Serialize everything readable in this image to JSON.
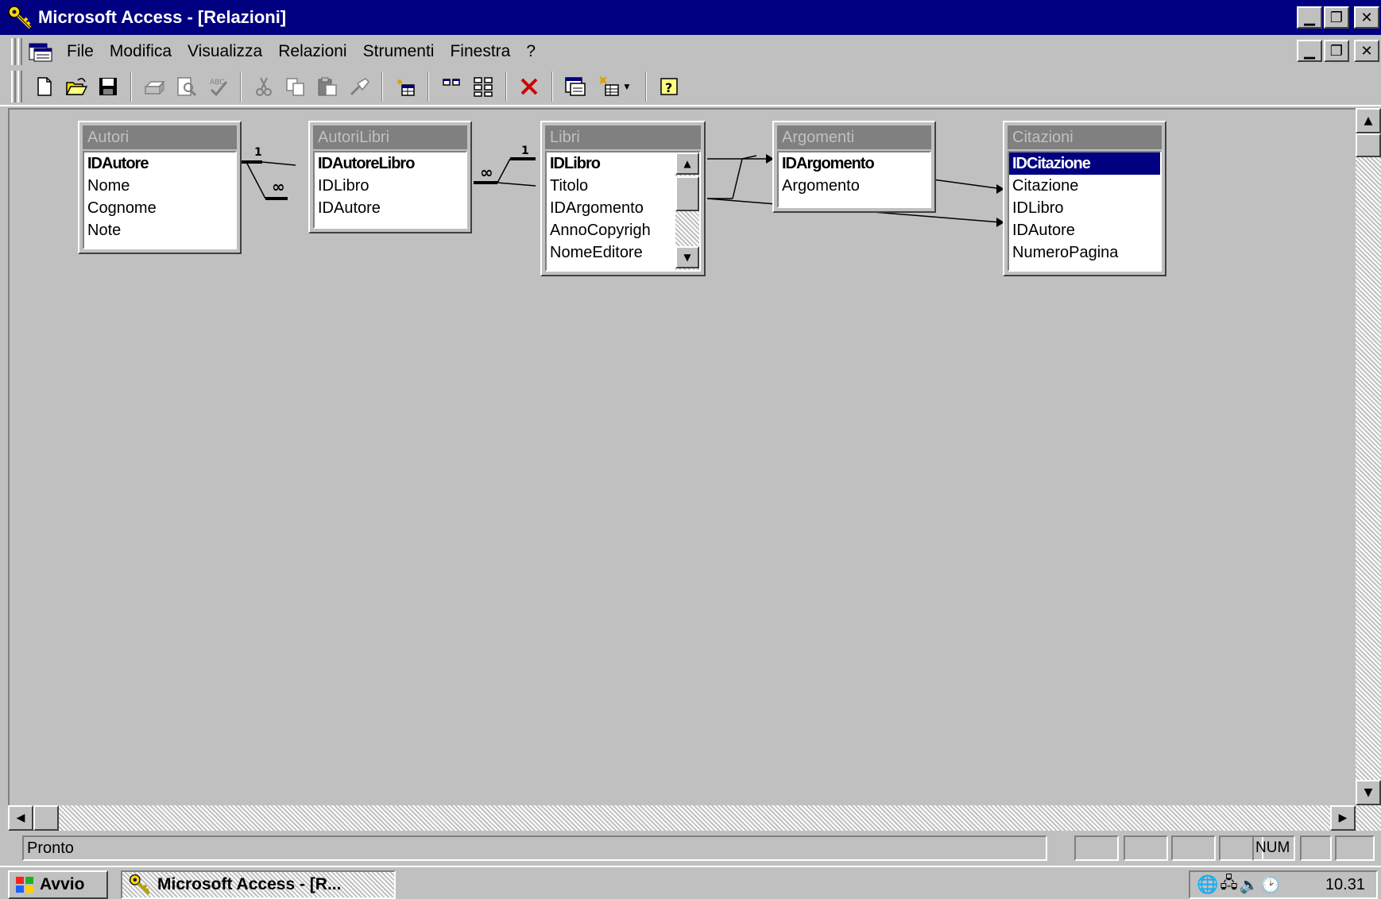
{
  "window": {
    "title": "Microsoft Access - [Relazioni]",
    "controls": {
      "minimize": "_",
      "restore": "🗗",
      "close": "✕"
    }
  },
  "menu": {
    "items": [
      "File",
      "Modifica",
      "Visualizza",
      "Relazioni",
      "Strumenti",
      "Finestra",
      "?"
    ],
    "underlines": [
      "F",
      "M",
      "V",
      "R",
      "S",
      "n",
      "?"
    ]
  },
  "toolbar": {
    "buttons": [
      "new-icon",
      "open-icon",
      "save-icon",
      "print-icon",
      "print-preview-icon",
      "spelling-icon",
      "cut-icon",
      "copy-icon",
      "paste-icon",
      "format-painter-icon",
      "show-table-icon",
      "show-direct-icon",
      "show-all-icon",
      "delete-icon",
      "database-window-icon",
      "new-object-icon",
      "help-icon"
    ]
  },
  "relationships": {
    "one_label": "1",
    "many_label": "∞",
    "tables": [
      {
        "id": "autori",
        "title": "Autori",
        "fields": [
          "IDAutore",
          "Nome",
          "Cognome",
          "Note"
        ],
        "primary_key": "IDAutore"
      },
      {
        "id": "autorilibri",
        "title": "AutoriLibri",
        "fields": [
          "IDAutoreLibro",
          "IDLibro",
          "IDAutore"
        ],
        "primary_key": "IDAutoreLibro"
      },
      {
        "id": "libri",
        "title": "Libri",
        "fields": [
          "IDLibro",
          "Titolo",
          "IDArgomento",
          "AnnoCopyrigh",
          "NomeEditore"
        ],
        "primary_key": "IDLibro"
      },
      {
        "id": "argomenti",
        "title": "Argomenti",
        "fields": [
          "IDArgomento",
          "Argomento"
        ],
        "primary_key": "IDArgomento"
      },
      {
        "id": "citazioni",
        "title": "Citazioni",
        "fields": [
          "IDCitazione",
          "Citazione",
          "IDLibro",
          "IDAutore",
          "NumeroPagina"
        ],
        "primary_key": "IDCitazione",
        "selected": "IDCitazione"
      }
    ]
  },
  "status": {
    "text": "Pronto",
    "num": "NUM"
  },
  "taskbar": {
    "start": "Avvio",
    "task": "Microsoft Access - [R...",
    "clock": "10.31"
  },
  "colors": {
    "titlebar": "#000080",
    "face": "#c0c0c0",
    "inactive_caption": "#808080",
    "selection": "#000080"
  }
}
